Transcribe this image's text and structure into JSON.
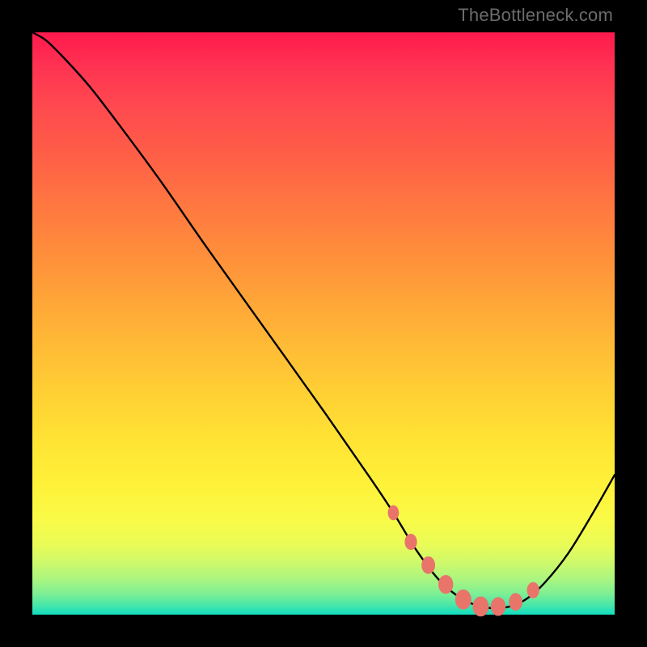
{
  "watermark": "TheBottleneck.com",
  "colors": {
    "page_bg": "#000000",
    "curve": "#000000",
    "dots": "#e9746a",
    "gradient_top": "#ff1a4d",
    "gradient_bottom": "#11ddc0"
  },
  "chart_data": {
    "type": "line",
    "title": "",
    "xlabel": "",
    "ylabel": "",
    "xlim": [
      0,
      100
    ],
    "ylim": [
      0,
      100
    ],
    "grid": false,
    "legend": false,
    "note": "Axes unlabeled in source image; values are proportional positions (0–100) estimated from pixel geometry. Curve descends from upper-left, reaches a flat minimum near x≈68–82, then rises toward the right edge.",
    "series": [
      {
        "name": "curve",
        "x": [
          0,
          2.5,
          6,
          10,
          15,
          22,
          30,
          40,
          50,
          58,
          62,
          66,
          70,
          74,
          78,
          82,
          85,
          88,
          92,
          96,
          100
        ],
        "y": [
          100,
          98.5,
          95,
          90.5,
          84,
          74.5,
          63,
          49,
          35,
          23.5,
          17.5,
          11,
          5.8,
          2.6,
          1.2,
          1.4,
          2.8,
          5.5,
          10.5,
          17,
          24
        ]
      }
    ],
    "markers": {
      "name": "highlight-dots",
      "x": [
        62,
        65,
        68,
        71,
        74,
        77,
        80,
        83,
        86
      ],
      "y": [
        17.5,
        12.5,
        8.5,
        5.2,
        2.6,
        1.4,
        1.4,
        2.2,
        4.2
      ],
      "rx": [
        1.6,
        1.8,
        2.0,
        2.2,
        2.4,
        2.4,
        2.2,
        2.0,
        1.8
      ],
      "ry": [
        2.2,
        2.4,
        2.6,
        2.8,
        3.0,
        3.0,
        2.8,
        2.6,
        2.4
      ]
    }
  }
}
